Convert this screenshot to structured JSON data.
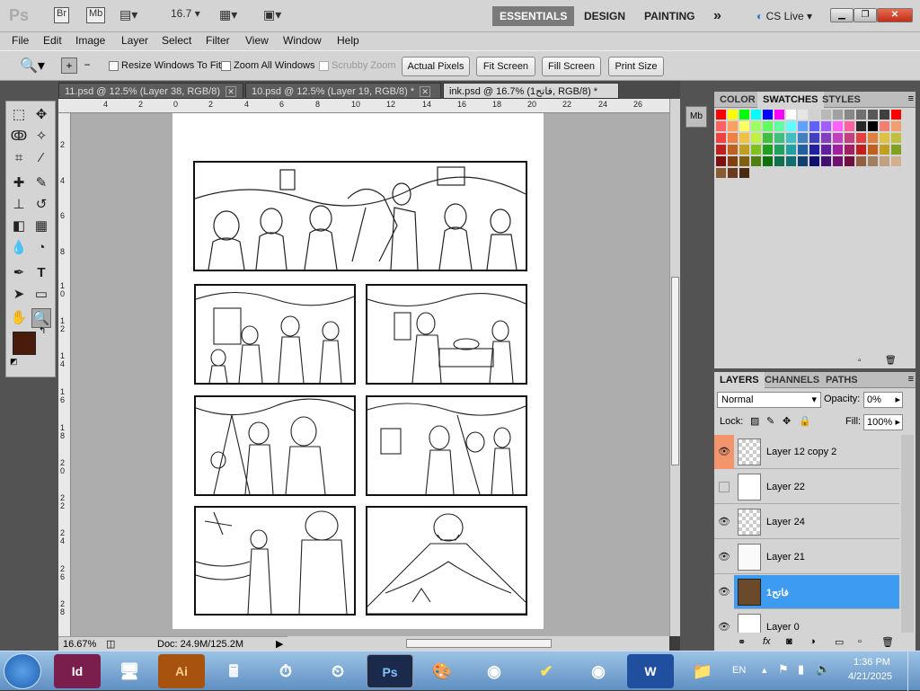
{
  "appbar": {
    "ps_logo": "Ps",
    "bridge": "Br",
    "minibridge": "Mb",
    "zoom_value": "16.7",
    "workspaces": [
      "ESSENTIALS",
      "DESIGN",
      "PAINTING"
    ],
    "more": "»",
    "cslive": "CS Live",
    "minimize_icon": "minimize-icon",
    "restore_icon": "restore-icon",
    "close_icon": "close-icon"
  },
  "menubar": {
    "items": [
      "File",
      "Edit",
      "Image",
      "Layer",
      "Select",
      "Filter",
      "View",
      "Window",
      "Help"
    ]
  },
  "options": {
    "resize_windows": "Resize Windows To Fit",
    "zoom_all": "Zoom All Windows",
    "scrubby": "Scrubby Zoom",
    "actual_pixels": "Actual Pixels",
    "fit_screen": "Fit Screen",
    "fill_screen": "Fill Screen",
    "print_size": "Print Size"
  },
  "tabs": [
    {
      "label": "11.psd @ 12.5% (Layer 38, RGB/8)",
      "active": false
    },
    {
      "label": "10.psd @ 12.5% (Layer 19, RGB/8) *",
      "active": false
    },
    {
      "label": "ink.psd @ 16.7% (1فاتح, RGB/8) *",
      "active": true
    }
  ],
  "ruler_h": [
    "4",
    "2",
    "0",
    "2",
    "4",
    "6",
    "8",
    "10",
    "12",
    "14",
    "16",
    "18",
    "20",
    "22",
    "24",
    "26"
  ],
  "ruler_v": [
    "2",
    "4",
    "6",
    "8",
    "1 0",
    "1 2",
    "1 4",
    "1 6",
    "1 8",
    "2 0",
    "2 2",
    "2 4",
    "2 6",
    "2 8"
  ],
  "status": {
    "zoom": "16.67%",
    "doc": "Doc: 24.9M/125.2M"
  },
  "colors": {
    "foreground": "#4a1a0a",
    "background": "#f08a60",
    "selected_layer": "#3d9bf2"
  },
  "panels": {
    "top_tabs": [
      "COLOR",
      "SWATCHES",
      "STYLES"
    ],
    "top_active": "SWATCHES",
    "layer_tabs": [
      "LAYERS",
      "CHANNELS",
      "PATHS"
    ],
    "layer_active": "LAYERS",
    "blend_mode": "Normal",
    "opacity_label": "Opacity:",
    "opacity_value": "0%",
    "lock_label": "Lock:",
    "fill_label": "Fill:",
    "fill_value": "100%",
    "layers": [
      {
        "name": "Layer 12 copy 2",
        "visible": true,
        "selected": false
      },
      {
        "name": "Layer 22",
        "visible": false,
        "selected": false
      },
      {
        "name": "Layer 24",
        "visible": true,
        "selected": false
      },
      {
        "name": "Layer 21",
        "visible": true,
        "selected": false
      },
      {
        "name": "فاتح1",
        "visible": true,
        "selected": true
      },
      {
        "name": "Layer 0",
        "visible": true,
        "selected": false
      }
    ]
  },
  "swatch_colors": [
    "#ff0000",
    "#ffff00",
    "#00ff00",
    "#00ffff",
    "#0000ff",
    "#ff00ff",
    "#ffffff",
    "#e6e6e6",
    "#d0d0d0",
    "#b8b8b8",
    "#a0a0a0",
    "#888888",
    "#707070",
    "#585858",
    "#404040",
    "#ff0000",
    "#ff6060",
    "#ffa060",
    "#ffff60",
    "#a0ff60",
    "#60ff60",
    "#60ffa0",
    "#60ffff",
    "#60a0ff",
    "#6060ff",
    "#a060ff",
    "#ff60ff",
    "#ff60a0",
    "#282828",
    "#000000",
    "#f08070",
    "#f0a070",
    "#f04040",
    "#f08040",
    "#f0c040",
    "#c0f040",
    "#40c040",
    "#40c080",
    "#40c0c0",
    "#4080c0",
    "#4040c0",
    "#8040c0",
    "#c040c0",
    "#c04080",
    "#e04040",
    "#e08040",
    "#e0c040",
    "#c0c040",
    "#c02020",
    "#c06020",
    "#c0a020",
    "#80c020",
    "#20a020",
    "#20a060",
    "#20a0a0",
    "#2060a0",
    "#2020a0",
    "#6020a0",
    "#a020a0",
    "#a02060",
    "#c02020",
    "#c06020",
    "#c0a020",
    "#80a020",
    "#801010",
    "#804010",
    "#806010",
    "#508010",
    "#107010",
    "#107050",
    "#107070",
    "#104070",
    "#101070",
    "#401070",
    "#701070",
    "#701040",
    "#906040",
    "#a08060",
    "#c0a080",
    "#d0b090",
    "#8a5a30",
    "#6a3a20",
    "#4a2a10"
  ],
  "taskbar": {
    "lang": "EN",
    "time": "1:36 PM",
    "date": "4/21/2025",
    "apps": [
      "Id",
      "Ai",
      "Ps",
      "W"
    ]
  }
}
